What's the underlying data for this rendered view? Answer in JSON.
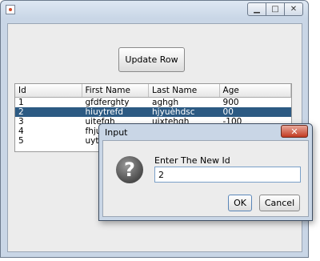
{
  "window": {
    "title": "",
    "icon": "java-app-icon"
  },
  "window_controls": [
    "minimize",
    "maximize",
    "close"
  ],
  "update_button": {
    "label": "Update Row"
  },
  "table": {
    "columns": [
      "Id",
      "First Name",
      "Last Name",
      "Age"
    ],
    "rows": [
      [
        "1",
        "gfdferghty",
        "aghgh",
        "900"
      ],
      [
        "2",
        "hiuytrefd",
        "hjyuèhdsc",
        "00"
      ],
      [
        "3",
        "uitefgh",
        "uixtehgh",
        "-100"
      ],
      [
        "4",
        "fhjuy",
        "",
        ""
      ],
      [
        "5",
        "uytre",
        "",
        ""
      ]
    ],
    "selected_row": 1
  },
  "dialog": {
    "title": "Input",
    "close_label": "✕",
    "icon": "question-icon",
    "prompt": "Enter The New Id",
    "input_value": "2",
    "ok_label": "OK",
    "cancel_label": "Cancel"
  }
}
